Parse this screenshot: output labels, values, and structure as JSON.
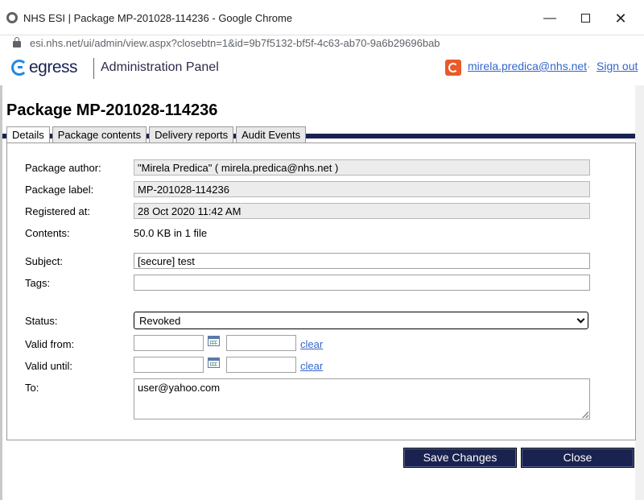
{
  "window": {
    "title": "NHS ESI | Package MP-201028-114236 - Google Chrome",
    "controls": {
      "minimize": "—",
      "close": "✕"
    }
  },
  "urlbar": {
    "url": "esi.nhs.net/ui/admin/view.aspx?closebtn=1&id=9b7f5132-bf5f-4c63-ab70-9a6b29696bab"
  },
  "header": {
    "logo_text": "egress",
    "panel_title": "Administration Panel",
    "user_email": "mirela.predica@nhs.net",
    "separator": "·",
    "signout": "Sign out"
  },
  "page": {
    "title": "Package MP-201028-114236"
  },
  "tabs": [
    {
      "label": "Details",
      "active": true
    },
    {
      "label": "Package contents",
      "active": false
    },
    {
      "label": "Delivery reports",
      "active": false
    },
    {
      "label": "Audit Events",
      "active": false
    }
  ],
  "details": {
    "author_label": "Package author:",
    "author_value": "\"Mirela Predica\" ( mirela.predica@nhs.net )",
    "label_label": "Package label:",
    "label_value": "MP-201028-114236",
    "registered_label": "Registered at:",
    "registered_value": "28 Oct 2020 11:42 AM",
    "contents_label": "Contents:",
    "contents_value": "50.0 KB in 1 file",
    "subject_label": "Subject:",
    "subject_value": "[secure] test",
    "tags_label": "Tags:",
    "tags_value": "",
    "status_label": "Status:",
    "status_value": "Revoked",
    "valid_from_label": "Valid from:",
    "valid_until_label": "Valid until:",
    "clear_label": "clear",
    "to_label": "To:",
    "to_value": "user@yahoo.com"
  },
  "buttons": {
    "save": "Save Changes",
    "close": "Close"
  },
  "colors": {
    "brand_navy": "#1a2250",
    "link": "#3366cc",
    "accent_orange": "#ea5a2a"
  }
}
